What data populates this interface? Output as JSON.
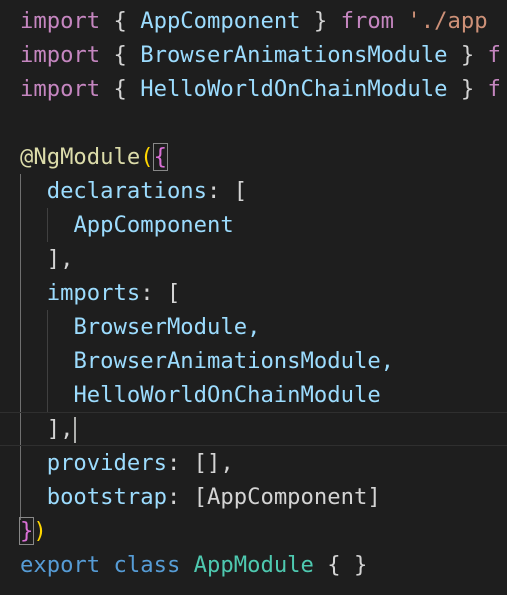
{
  "editor": {
    "language": "typescript",
    "theme": "dark",
    "colors": {
      "background": "#1e1e1e",
      "keyword": "#569cd6",
      "control_keyword": "#c586c0",
      "string": "#ce9178",
      "class_name": "#4ec9b0",
      "property": "#9cdcfe",
      "decorator": "#dcdcaa",
      "bracket": "#ffd700",
      "text": "#d4d4d4"
    },
    "lines": [
      {
        "kw": "import",
        "open": " { ",
        "name": "AppComponent",
        "close": " } ",
        "from": "from",
        "sp": " ",
        "path": "'./app"
      },
      {
        "kw": "import",
        "open": " { ",
        "name": "BrowserAnimationsModule",
        "close": " } ",
        "tail": "f"
      },
      {
        "kw": "import",
        "open": " { ",
        "name": "HelloWorldOnChainModule",
        "close": " } ",
        "tail": "f"
      },
      {
        "blank": ""
      },
      {
        "at": "@",
        "decorator": "NgModule",
        "paren": "(",
        "brace": "{"
      },
      {
        "indent": "  ",
        "prop": "declarations",
        "sep": ": ",
        "bracket": "["
      },
      {
        "indent": "    ",
        "value": "AppComponent"
      },
      {
        "indent": "  ",
        "close": "],"
      },
      {
        "indent": "  ",
        "prop": "imports",
        "sep": ": ",
        "bracket": "["
      },
      {
        "indent": "    ",
        "value": "BrowserModule,"
      },
      {
        "indent": "    ",
        "value": "BrowserAnimationsModule,"
      },
      {
        "indent": "    ",
        "value": "HelloWorldOnChainModule"
      },
      {
        "indent": "  ",
        "close": "],"
      },
      {
        "indent": "  ",
        "prop": "providers",
        "sep": ": ",
        "rest": "[],"
      },
      {
        "indent": "  ",
        "prop": "bootstrap",
        "sep": ": ",
        "rest": "[AppComponent]"
      },
      {
        "brace": "}",
        "paren": ")"
      },
      {
        "kw1": "export",
        "sp1": " ",
        "kw2": "class",
        "sp2": " ",
        "name": "AppModule",
        "rest": " { }"
      }
    ]
  }
}
